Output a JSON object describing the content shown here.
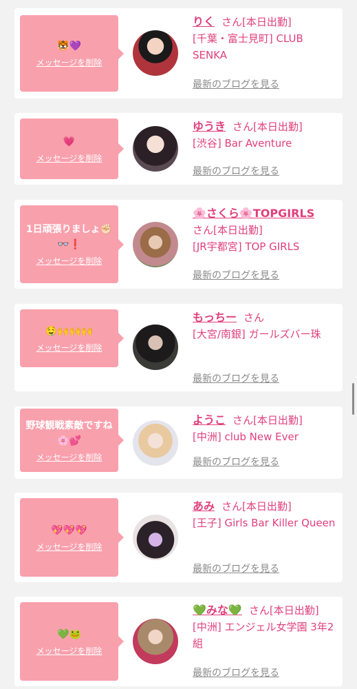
{
  "delete_label": "メッセージを削除",
  "blog_label": "最新のブログを見る",
  "colors": {
    "accent": "#e0407a",
    "bubble": "#f9a0ad",
    "link_gray": "#8a8a8a"
  },
  "entries": [
    {
      "message": "🐯💜",
      "name": "りく",
      "suffix": "さん[本日出勤]",
      "shop": "[千葉・富士見町] CLUB SENKA",
      "avatar_icon": "woman-portrait-photo"
    },
    {
      "message": "💗",
      "name": "ゆうき",
      "suffix": "さん[本日出勤]",
      "shop": "[渋谷] Bar Aventure",
      "avatar_icon": "woman-portrait-photo"
    },
    {
      "message": "1日頑張りましょ✊🏻👓❗",
      "name": "🌸さくら🌸TOPGIRLS",
      "suffix": "さん[本日出勤]",
      "shop": "[JR宇都宮] TOP GIRLS",
      "avatar_icon": "woman-portrait-photo"
    },
    {
      "message": "🤤🙌🙌🙌",
      "name": "もっちー",
      "suffix": "さん",
      "shop": "[大宮/南銀] ガールズバー珠",
      "avatar_icon": "woman-portrait-photo"
    },
    {
      "message": "野球観戦素敵ですね🌸💕",
      "name": "ようこ",
      "suffix": "さん[本日出勤]",
      "shop": "[中洲] club New Ever",
      "avatar_icon": "woman-portrait-photo"
    },
    {
      "message": "💖💖💖",
      "name": "あみ",
      "suffix": "さん[本日出勤]",
      "shop": "[王子] Girls Bar Killer Queen",
      "avatar_icon": "woman-portrait-photo"
    },
    {
      "message": "💚🐸",
      "name": "💚みな💚",
      "suffix": "さん[本日出勤]",
      "shop": "[中洲] エンジェル女学園 3年2組",
      "avatar_icon": "woman-portrait-photo"
    }
  ]
}
